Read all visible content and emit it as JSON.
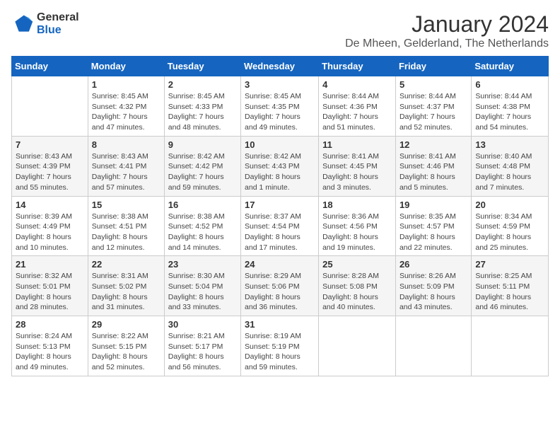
{
  "header": {
    "logo_line1": "General",
    "logo_line2": "Blue",
    "title": "January 2024",
    "subtitle": "De Mheen, Gelderland, The Netherlands"
  },
  "weekdays": [
    "Sunday",
    "Monday",
    "Tuesday",
    "Wednesday",
    "Thursday",
    "Friday",
    "Saturday"
  ],
  "weeks": [
    [
      {
        "day": "",
        "sunrise": "",
        "sunset": "",
        "daylight": ""
      },
      {
        "day": "1",
        "sunrise": "Sunrise: 8:45 AM",
        "sunset": "Sunset: 4:32 PM",
        "daylight": "Daylight: 7 hours and 47 minutes."
      },
      {
        "day": "2",
        "sunrise": "Sunrise: 8:45 AM",
        "sunset": "Sunset: 4:33 PM",
        "daylight": "Daylight: 7 hours and 48 minutes."
      },
      {
        "day": "3",
        "sunrise": "Sunrise: 8:45 AM",
        "sunset": "Sunset: 4:35 PM",
        "daylight": "Daylight: 7 hours and 49 minutes."
      },
      {
        "day": "4",
        "sunrise": "Sunrise: 8:44 AM",
        "sunset": "Sunset: 4:36 PM",
        "daylight": "Daylight: 7 hours and 51 minutes."
      },
      {
        "day": "5",
        "sunrise": "Sunrise: 8:44 AM",
        "sunset": "Sunset: 4:37 PM",
        "daylight": "Daylight: 7 hours and 52 minutes."
      },
      {
        "day": "6",
        "sunrise": "Sunrise: 8:44 AM",
        "sunset": "Sunset: 4:38 PM",
        "daylight": "Daylight: 7 hours and 54 minutes."
      }
    ],
    [
      {
        "day": "7",
        "sunrise": "Sunrise: 8:43 AM",
        "sunset": "Sunset: 4:39 PM",
        "daylight": "Daylight: 7 hours and 55 minutes."
      },
      {
        "day": "8",
        "sunrise": "Sunrise: 8:43 AM",
        "sunset": "Sunset: 4:41 PM",
        "daylight": "Daylight: 7 hours and 57 minutes."
      },
      {
        "day": "9",
        "sunrise": "Sunrise: 8:42 AM",
        "sunset": "Sunset: 4:42 PM",
        "daylight": "Daylight: 7 hours and 59 minutes."
      },
      {
        "day": "10",
        "sunrise": "Sunrise: 8:42 AM",
        "sunset": "Sunset: 4:43 PM",
        "daylight": "Daylight: 8 hours and 1 minute."
      },
      {
        "day": "11",
        "sunrise": "Sunrise: 8:41 AM",
        "sunset": "Sunset: 4:45 PM",
        "daylight": "Daylight: 8 hours and 3 minutes."
      },
      {
        "day": "12",
        "sunrise": "Sunrise: 8:41 AM",
        "sunset": "Sunset: 4:46 PM",
        "daylight": "Daylight: 8 hours and 5 minutes."
      },
      {
        "day": "13",
        "sunrise": "Sunrise: 8:40 AM",
        "sunset": "Sunset: 4:48 PM",
        "daylight": "Daylight: 8 hours and 7 minutes."
      }
    ],
    [
      {
        "day": "14",
        "sunrise": "Sunrise: 8:39 AM",
        "sunset": "Sunset: 4:49 PM",
        "daylight": "Daylight: 8 hours and 10 minutes."
      },
      {
        "day": "15",
        "sunrise": "Sunrise: 8:38 AM",
        "sunset": "Sunset: 4:51 PM",
        "daylight": "Daylight: 8 hours and 12 minutes."
      },
      {
        "day": "16",
        "sunrise": "Sunrise: 8:38 AM",
        "sunset": "Sunset: 4:52 PM",
        "daylight": "Daylight: 8 hours and 14 minutes."
      },
      {
        "day": "17",
        "sunrise": "Sunrise: 8:37 AM",
        "sunset": "Sunset: 4:54 PM",
        "daylight": "Daylight: 8 hours and 17 minutes."
      },
      {
        "day": "18",
        "sunrise": "Sunrise: 8:36 AM",
        "sunset": "Sunset: 4:56 PM",
        "daylight": "Daylight: 8 hours and 19 minutes."
      },
      {
        "day": "19",
        "sunrise": "Sunrise: 8:35 AM",
        "sunset": "Sunset: 4:57 PM",
        "daylight": "Daylight: 8 hours and 22 minutes."
      },
      {
        "day": "20",
        "sunrise": "Sunrise: 8:34 AM",
        "sunset": "Sunset: 4:59 PM",
        "daylight": "Daylight: 8 hours and 25 minutes."
      }
    ],
    [
      {
        "day": "21",
        "sunrise": "Sunrise: 8:32 AM",
        "sunset": "Sunset: 5:01 PM",
        "daylight": "Daylight: 8 hours and 28 minutes."
      },
      {
        "day": "22",
        "sunrise": "Sunrise: 8:31 AM",
        "sunset": "Sunset: 5:02 PM",
        "daylight": "Daylight: 8 hours and 31 minutes."
      },
      {
        "day": "23",
        "sunrise": "Sunrise: 8:30 AM",
        "sunset": "Sunset: 5:04 PM",
        "daylight": "Daylight: 8 hours and 33 minutes."
      },
      {
        "day": "24",
        "sunrise": "Sunrise: 8:29 AM",
        "sunset": "Sunset: 5:06 PM",
        "daylight": "Daylight: 8 hours and 36 minutes."
      },
      {
        "day": "25",
        "sunrise": "Sunrise: 8:28 AM",
        "sunset": "Sunset: 5:08 PM",
        "daylight": "Daylight: 8 hours and 40 minutes."
      },
      {
        "day": "26",
        "sunrise": "Sunrise: 8:26 AM",
        "sunset": "Sunset: 5:09 PM",
        "daylight": "Daylight: 8 hours and 43 minutes."
      },
      {
        "day": "27",
        "sunrise": "Sunrise: 8:25 AM",
        "sunset": "Sunset: 5:11 PM",
        "daylight": "Daylight: 8 hours and 46 minutes."
      }
    ],
    [
      {
        "day": "28",
        "sunrise": "Sunrise: 8:24 AM",
        "sunset": "Sunset: 5:13 PM",
        "daylight": "Daylight: 8 hours and 49 minutes."
      },
      {
        "day": "29",
        "sunrise": "Sunrise: 8:22 AM",
        "sunset": "Sunset: 5:15 PM",
        "daylight": "Daylight: 8 hours and 52 minutes."
      },
      {
        "day": "30",
        "sunrise": "Sunrise: 8:21 AM",
        "sunset": "Sunset: 5:17 PM",
        "daylight": "Daylight: 8 hours and 56 minutes."
      },
      {
        "day": "31",
        "sunrise": "Sunrise: 8:19 AM",
        "sunset": "Sunset: 5:19 PM",
        "daylight": "Daylight: 8 hours and 59 minutes."
      },
      {
        "day": "",
        "sunrise": "",
        "sunset": "",
        "daylight": ""
      },
      {
        "day": "",
        "sunrise": "",
        "sunset": "",
        "daylight": ""
      },
      {
        "day": "",
        "sunrise": "",
        "sunset": "",
        "daylight": ""
      }
    ]
  ]
}
